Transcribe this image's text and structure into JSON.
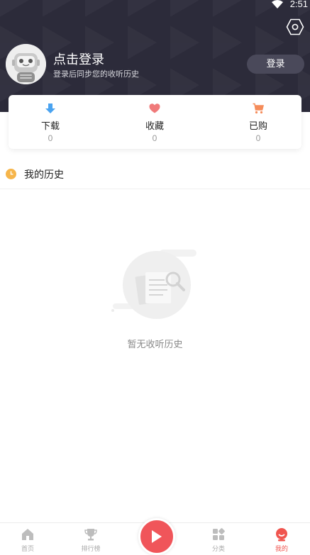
{
  "status_bar": {
    "time": "2:51"
  },
  "profile": {
    "title": "点击登录",
    "subtitle": "登录后同步您的收听历史",
    "login_button": "登录"
  },
  "stats": [
    {
      "label": "下载",
      "count": "0",
      "icon": "download-icon",
      "color": "#4aa3f0"
    },
    {
      "label": "收藏",
      "count": "0",
      "icon": "heart-icon",
      "color": "#f07a7a"
    },
    {
      "label": "已购",
      "count": "0",
      "icon": "cart-icon",
      "color": "#f58c5a"
    }
  ],
  "history": {
    "title": "我的历史",
    "empty_text": "暂无收听历史"
  },
  "tabbar": {
    "items": [
      {
        "label": "首页",
        "icon": "home-icon"
      },
      {
        "label": "排行榜",
        "icon": "trophy-icon"
      },
      {
        "label": "分类",
        "icon": "category-icon"
      },
      {
        "label": "我的",
        "icon": "profile-icon"
      }
    ],
    "active_color": "#f0554f"
  },
  "colors": {
    "header_bg": "#2c2b3a",
    "accent": "#f0555a"
  }
}
